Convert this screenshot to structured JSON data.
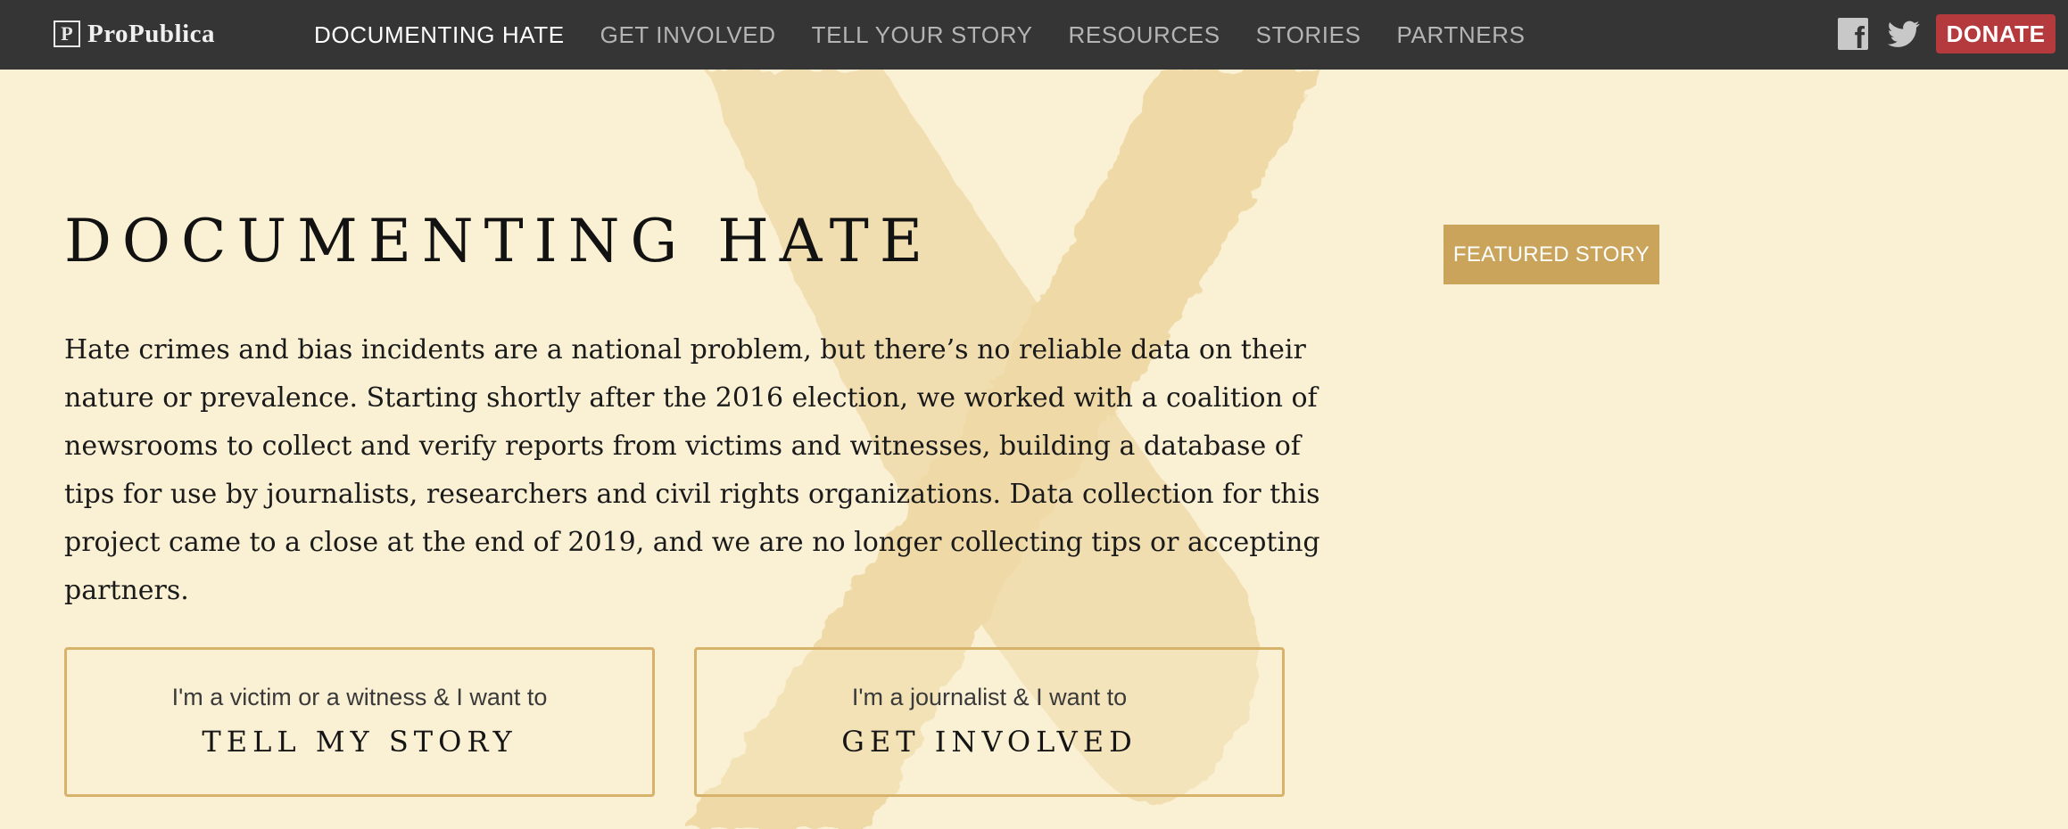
{
  "brand": {
    "logo_mark": "P",
    "logo_text": "ProPublica"
  },
  "nav": {
    "items": [
      {
        "label": "DOCUMENTING HATE",
        "active": true
      },
      {
        "label": "GET INVOLVED",
        "active": false
      },
      {
        "label": "TELL YOUR STORY",
        "active": false
      },
      {
        "label": "RESOURCES",
        "active": false
      },
      {
        "label": "STORIES",
        "active": false
      },
      {
        "label": "PARTNERS",
        "active": false
      }
    ],
    "social": [
      "facebook-icon",
      "twitter-icon"
    ],
    "donate_label": "DONATE"
  },
  "hero": {
    "title": "DOCUMENTING HATE",
    "intro": "Hate crimes and bias incidents are a national problem, but there’s no reliable data on their nature or prevalence. Starting shortly after the 2016 election, we worked with a coalition of newsrooms to collect and verify reports from victims and witnesses, building a database of tips for use by journalists, researchers and civil rights organizations. Data collection for this project came to a close at the end of 2019, and we are no longer collecting tips or accepting partners.",
    "featured_label": "FEATURED STORY"
  },
  "cta": {
    "victim": {
      "subtitle": "I'm a victim or a witness & I want to",
      "action": "TELL MY STORY"
    },
    "journalist": {
      "subtitle": "I'm a journalist & I want to",
      "action": "GET INVOLVED"
    }
  },
  "colors": {
    "background": "#faf0d4",
    "nav_bg": "#353535",
    "accent_gold": "#c9a45a",
    "donate_red": "#b53a3e"
  }
}
